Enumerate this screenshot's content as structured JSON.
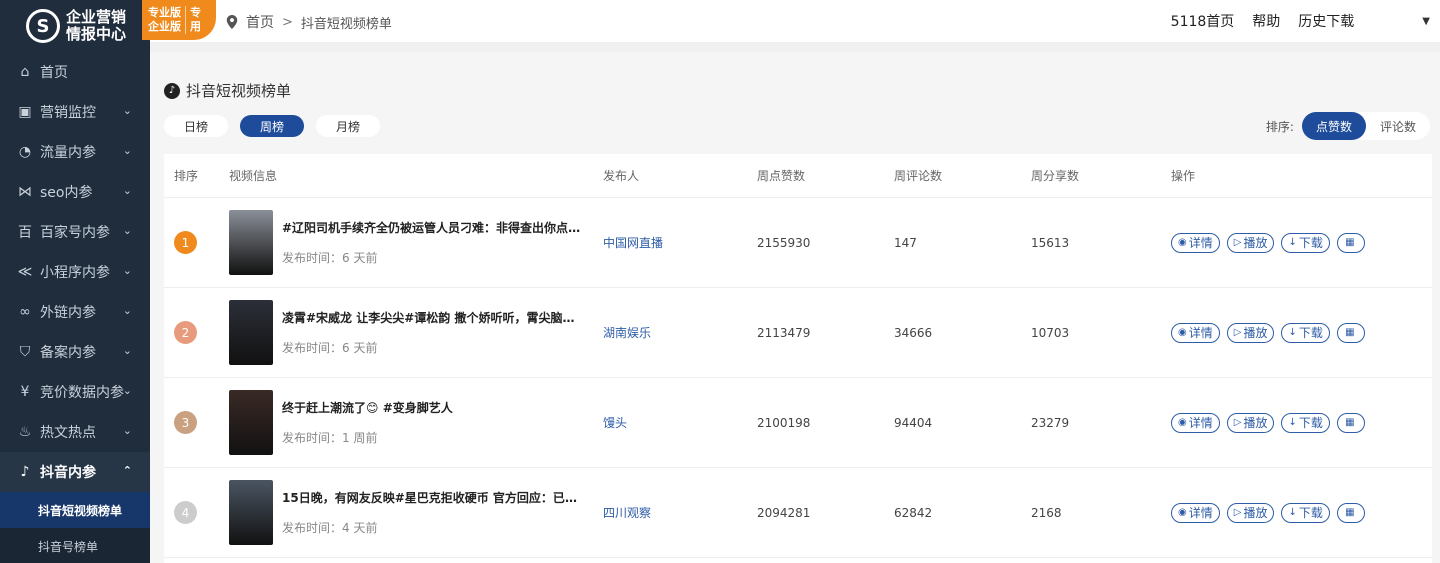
{
  "brand": {
    "logo_text_1": "企业营销",
    "logo_text_2": "情报中心",
    "logo_icon": "s-logo-icon"
  },
  "badge": {
    "left_1": "专业版",
    "left_2": "企业版",
    "right_1": "专",
    "right_2": "用"
  },
  "breadcrumb": {
    "home": "首页",
    "separator": ">",
    "current": "抖音短视频榜单"
  },
  "header_links": {
    "home": "5118首页",
    "help": "帮助",
    "history": "历史下载"
  },
  "menu": [
    {
      "label": "首页",
      "icon": "home-icon",
      "has_children": false
    },
    {
      "label": "营销监控",
      "icon": "monitor-icon",
      "has_children": true
    },
    {
      "label": "流量内参",
      "icon": "flow-icon",
      "has_children": true
    },
    {
      "label": "seo内参",
      "icon": "seo-icon",
      "has_children": true
    },
    {
      "label": "百家号内参",
      "icon": "baijiahao-icon",
      "has_children": true
    },
    {
      "label": "小程序内参",
      "icon": "miniprogram-icon",
      "has_children": true
    },
    {
      "label": "外链内参",
      "icon": "link-icon",
      "has_children": true
    },
    {
      "label": "备案内参",
      "icon": "shield-icon",
      "has_children": true
    },
    {
      "label": "竞价数据内参",
      "icon": "bid-icon",
      "has_children": true
    },
    {
      "label": "热文热点",
      "icon": "fire-icon",
      "has_children": true
    },
    {
      "label": "抖音内参",
      "icon": "tiktok-icon",
      "has_children": true,
      "active": true
    }
  ],
  "submenu": [
    {
      "label": "抖音短视频榜单",
      "active": true
    },
    {
      "label": "抖音号榜单",
      "active": false
    }
  ],
  "page": {
    "title": "抖音短视频榜单"
  },
  "tabs": [
    {
      "label": "日榜",
      "active": false
    },
    {
      "label": "周榜",
      "active": true
    },
    {
      "label": "月榜",
      "active": false
    }
  ],
  "sort": {
    "label": "排序:",
    "options": [
      {
        "label": "点赞数",
        "active": true
      },
      {
        "label": "评论数",
        "active": false
      }
    ]
  },
  "table": {
    "headers": {
      "rank": "排序",
      "info": "视频信息",
      "publisher": "发布人",
      "likes": "周点赞数",
      "comments": "周评论数",
      "shares": "周分享数",
      "ops": "操作"
    },
    "ops_labels": {
      "detail": "详情",
      "play": "播放",
      "download": "下载"
    },
    "rows": [
      {
        "rank": "1",
        "rank_color": "#f08a1c",
        "title": "#辽阳司机手续齐全仍被运管人员刁难：非得查出你点儿...",
        "time": "发布时间：6 天前",
        "publisher": "中国网直播",
        "likes": "2155930",
        "comments": "147",
        "shares": "15613",
        "thumb_color": "#8a8f98"
      },
      {
        "rank": "2",
        "rank_color": "#e89a7c",
        "title": "凌霄#宋威龙 让李尖尖#谭松韵 撒个娇听听，霄尖脑袋🙈...",
        "time": "发布时间：6 天前",
        "publisher": "湖南娱乐",
        "likes": "2113479",
        "comments": "34666",
        "shares": "10703",
        "thumb_color": "#2b2f38"
      },
      {
        "rank": "3",
        "rank_color": "#c9a080",
        "title": "终于赶上潮流了😊 #变身脚艺人",
        "time": "发布时间：1 周前",
        "publisher": "馒头",
        "likes": "2100198",
        "comments": "94404",
        "shares": "23279",
        "thumb_color": "#3a2a26"
      },
      {
        "rank": "4",
        "rank_color": "#cccccc",
        "title": "15日晚，有网友反映#星巴克拒收硬币 官方回应：已重申...",
        "time": "发布时间：4 天前",
        "publisher": "四川观察",
        "likes": "2094281",
        "comments": "62842",
        "shares": "2168",
        "thumb_color": "#4a5562"
      }
    ]
  }
}
